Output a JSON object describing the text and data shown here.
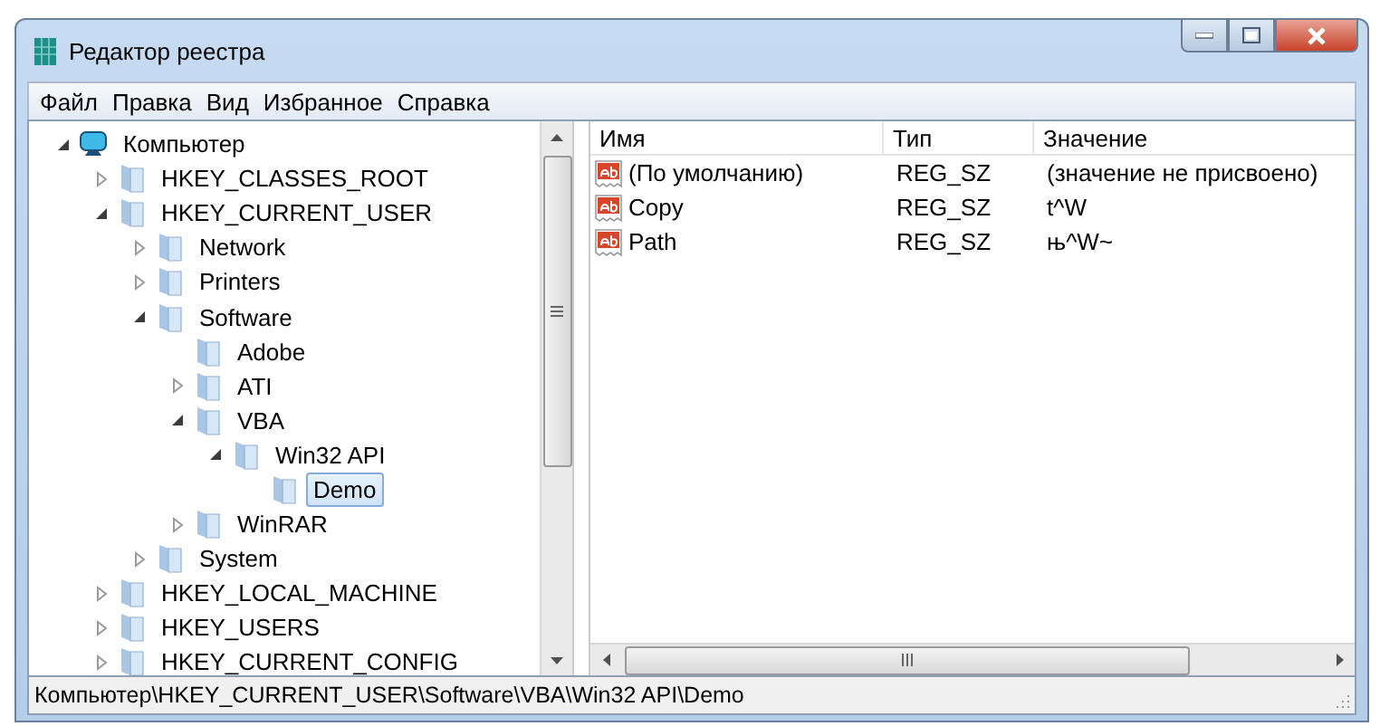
{
  "window": {
    "title": "Редактор реестра"
  },
  "menu": [
    "Файл",
    "Правка",
    "Вид",
    "Избранное",
    "Справка"
  ],
  "tree": [
    {
      "label": "Компьютер",
      "kind": "computer",
      "expanded": true,
      "selected": false,
      "children": [
        {
          "label": "HKEY_CLASSES_ROOT",
          "kind": "folder",
          "expanded": false,
          "selected": false
        },
        {
          "label": "HKEY_CURRENT_USER",
          "kind": "folder",
          "expanded": true,
          "selected": false,
          "children": [
            {
              "label": "Network",
              "kind": "folder",
              "expanded": false,
              "selected": false
            },
            {
              "label": "Printers",
              "kind": "folder",
              "expanded": false,
              "selected": false
            },
            {
              "label": "Software",
              "kind": "folder",
              "expanded": true,
              "selected": false,
              "children": [
                {
                  "label": "Adobe",
                  "kind": "leaf",
                  "expanded": false,
                  "selected": false
                },
                {
                  "label": "ATI",
                  "kind": "folder",
                  "expanded": false,
                  "selected": false
                },
                {
                  "label": "VBA",
                  "kind": "folder",
                  "expanded": true,
                  "selected": false,
                  "children": [
                    {
                      "label": "Win32 API",
                      "kind": "folder",
                      "expanded": true,
                      "selected": false,
                      "children": [
                        {
                          "label": "Demo",
                          "kind": "leaf",
                          "expanded": false,
                          "selected": true
                        }
                      ]
                    }
                  ]
                },
                {
                  "label": "WinRAR",
                  "kind": "folder",
                  "expanded": false,
                  "selected": false
                }
              ]
            },
            {
              "label": "System",
              "kind": "folder",
              "expanded": false,
              "selected": false
            }
          ]
        },
        {
          "label": "HKEY_LOCAL_MACHINE",
          "kind": "folder",
          "expanded": false,
          "selected": false
        },
        {
          "label": "HKEY_USERS",
          "kind": "folder",
          "expanded": false,
          "selected": false
        },
        {
          "label": "HKEY_CURRENT_CONFIG",
          "kind": "folder",
          "expanded": false,
          "selected": false
        }
      ]
    }
  ],
  "values": {
    "columns": [
      "Имя",
      "Тип",
      "Значение"
    ],
    "rows": [
      [
        "(По умолчанию)",
        "REG_SZ",
        "(значение не присвоено)"
      ],
      [
        "Copy",
        "REG_SZ",
        "t^W"
      ],
      [
        "Path",
        "REG_SZ",
        "њ^W~"
      ]
    ]
  },
  "status_bar": "Компьютер\\HKEY_CURRENT_USER\\Software\\VBA\\Win32 API\\Demo"
}
